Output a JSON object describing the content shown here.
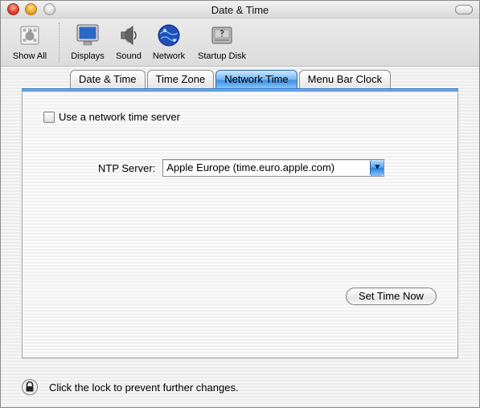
{
  "window": {
    "title": "Date & Time"
  },
  "toolbar": {
    "items": [
      {
        "label": "Show All",
        "icon": "show-all-icon"
      },
      {
        "label": "Displays",
        "icon": "displays-icon"
      },
      {
        "label": "Sound",
        "icon": "sound-icon"
      },
      {
        "label": "Network",
        "icon": "network-icon"
      },
      {
        "label": "Startup Disk",
        "icon": "startup-disk-icon"
      }
    ]
  },
  "tabs": [
    {
      "label": "Date & Time",
      "active": false
    },
    {
      "label": "Time Zone",
      "active": false
    },
    {
      "label": "Network Time",
      "active": true
    },
    {
      "label": "Menu Bar Clock",
      "active": false
    }
  ],
  "network_time": {
    "use_network_time_server_label": "Use a network time server",
    "use_network_time_server_checked": false,
    "ntp_server_label": "NTP Server:",
    "ntp_server_value": "Apple Europe (time.euro.apple.com)",
    "set_time_now_label": "Set Time Now"
  },
  "footer": {
    "lock_message": "Click the lock to prevent further changes."
  },
  "colors": {
    "accent_blue": "#3e8fe0",
    "window_bg": "#ececec"
  }
}
